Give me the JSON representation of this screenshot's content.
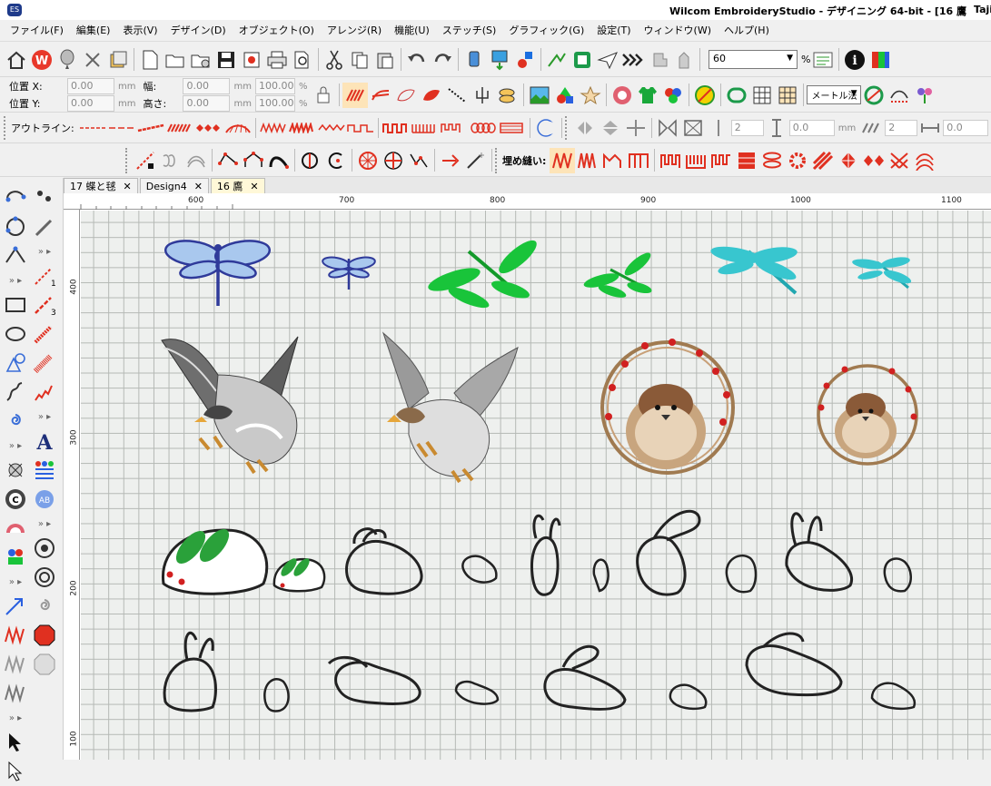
{
  "window": {
    "title": "Wilcom EmbroideryStudio - デザイニング 64-bit - [16 鷹",
    "user": "Taji"
  },
  "menu": [
    "ファイル(F)",
    "編集(E)",
    "表示(V)",
    "デザイン(D)",
    "オブジェクト(O)",
    "アレンジ(R)",
    "機能(U)",
    "ステッチ(S)",
    "グラフィック(G)",
    "設定(T)",
    "ウィンドウ(W)",
    "ヘルプ(H)"
  ],
  "toolbar_main": {
    "zoom_value": "60",
    "zoom_unit": "%"
  },
  "props_bar": {
    "pos_x_label": "位置 X:",
    "pos_y_label": "位置 Y:",
    "pos_x": "0.00",
    "pos_y": "0.00",
    "width_label": "幅:",
    "height_label": "高さ:",
    "width": "0.00",
    "height": "0.00",
    "unit": "mm",
    "scale_w": "100.00",
    "scale_h": "100.00",
    "pct": "%",
    "measure_combo": "メートル法"
  },
  "outline_bar": {
    "label": "アウトライン:",
    "spin1": "2",
    "spin2": "0.0",
    "spin3": "2",
    "spin4": "0.0",
    "unit": "mm"
  },
  "fill_bar": {
    "label": "埋め縫い:"
  },
  "tabs": [
    {
      "label": "17 蝶と毬",
      "close": "✕"
    },
    {
      "label": "Design4",
      "close": "✕"
    },
    {
      "label": "16 鷹",
      "close": "✕"
    }
  ],
  "ruler": {
    "h_labels": [
      "600",
      "700",
      "800",
      "900",
      "1000",
      "1100"
    ],
    "v_labels": [
      "400",
      "300",
      "200",
      "100"
    ]
  },
  "colors": {
    "blue": "#2f3a9a",
    "green": "#19c43a",
    "cyan": "#38c6cf",
    "red_icon": "#e03020",
    "outline": "#222222"
  }
}
